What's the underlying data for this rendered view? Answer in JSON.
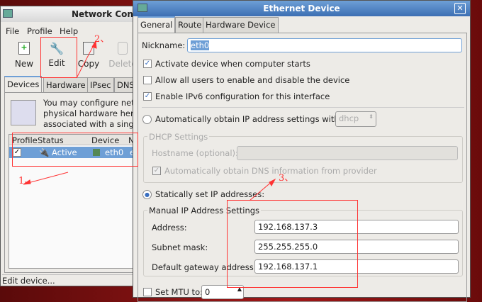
{
  "main_window": {
    "title": "Network Configuration",
    "title_visible": "Network Con",
    "menu": [
      "File",
      "Profile",
      "Help"
    ],
    "toolbar": [
      "New",
      "Edit",
      "Copy",
      "Delete"
    ],
    "tabs": [
      "Devices",
      "Hardware",
      "IPsec",
      "DNS"
    ],
    "description": [
      "You may configure net",
      "physical hardware here",
      "associated with a singl"
    ],
    "columns": [
      "Profile",
      "Status",
      "Device",
      "N"
    ],
    "rows": [
      {
        "profile_checked": true,
        "status": "Active",
        "device": "eth0",
        "nickname": "e"
      }
    ],
    "status_bar": "Edit device..."
  },
  "dialog": {
    "title": "Ethernet Device",
    "tabs": [
      "General",
      "Route",
      "Hardware Device"
    ],
    "nickname_label": "Nickname:",
    "nickname": "eth0",
    "activate_label": "Activate device when computer starts",
    "activate": true,
    "allow_users_label": "Allow all users to enable and disable the device",
    "allow_users": false,
    "ipv6_label": "Enable IPv6 configuration for this interface",
    "ipv6": true,
    "auto_label": "Automatically obtain IP address settings with:",
    "auto_method": "dhcp",
    "dhcp_title": "DHCP Settings",
    "hostname_label": "Hostname (optional):",
    "hostname": "",
    "dns_label": "Automatically obtain DNS information from provider",
    "static_label": "Statically set IP addresses:",
    "manual_title": "Manual IP Address Settings",
    "address_label": "Address:",
    "address": "192.168.137.3",
    "subnet_label": "Subnet mask:",
    "subnet": "255.255.255.0",
    "gateway_label": "Default gateway address:",
    "gateway": "192.168.137.1",
    "mtu_label": "Set MTU to:",
    "mtu": "0"
  },
  "annotations": [
    "1、",
    "2、",
    "3、"
  ],
  "colors": {
    "annotation": "#ff3333",
    "selection": "#6e9fd6"
  }
}
